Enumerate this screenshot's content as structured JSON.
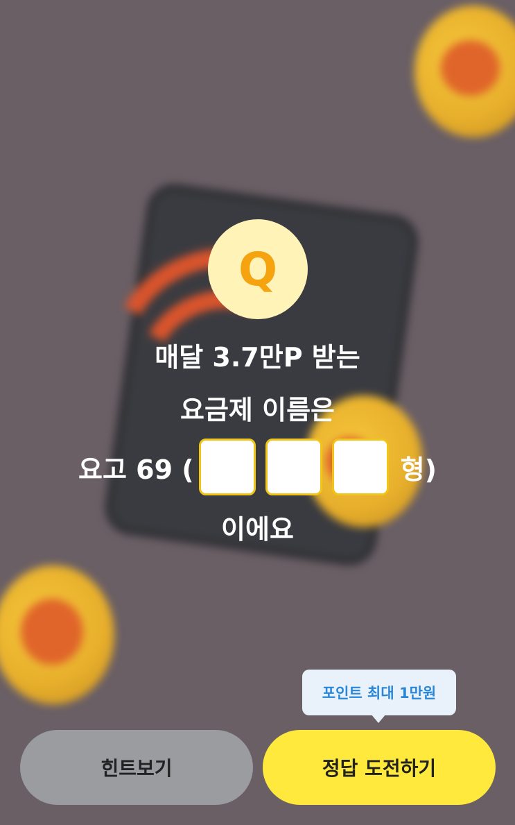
{
  "badge": {
    "letter": "Q"
  },
  "question": {
    "line1": "매달 3.7만P 받는",
    "line2": "요금제 이름은",
    "prefix": "요고 69 (",
    "suffix": "형)",
    "line4": "이에요"
  },
  "tooltip": {
    "text": "포인트 최대 1만원"
  },
  "buttons": {
    "hint_label": "힌트보기",
    "answer_label": "정답 도전하기"
  },
  "colors": {
    "overlay_bg": "#6a5f65",
    "badge_bg": "#fff3b8",
    "badge_letter": "#f5a30f",
    "blank_border": "#f0c419",
    "hint_button": "#9a9ca0",
    "answer_button": "#ffe93c",
    "tooltip_text": "#2a86d6"
  },
  "icons": [
    "q-badge-icon",
    "coin-chat-icon",
    "phone-illustration",
    "wifi-illustration"
  ]
}
